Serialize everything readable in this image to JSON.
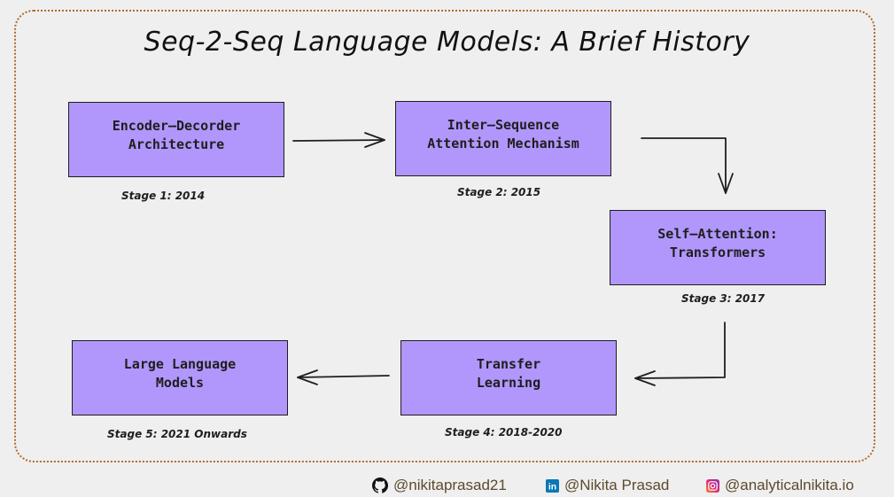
{
  "title": "Seq-2-Seq Language Models: A Brief History",
  "stages": [
    {
      "label": "Encoder—Decorder\nArchitecture",
      "caption": "Stage 1: 2014"
    },
    {
      "label": "Inter—Sequence\nAttention Mechanism",
      "caption": "Stage 2: 2015"
    },
    {
      "label": "Self—Attention:\nTransformers",
      "caption": "Stage 3: 2017"
    },
    {
      "label": "Transfer\nLearning",
      "caption": "Stage 4: 2018-2020"
    },
    {
      "label": "Large Language\nModels",
      "caption": "Stage 5: 2021 Onwards"
    }
  ],
  "colors": {
    "box_fill": "#b197fc",
    "frame_border": "#b06a2a",
    "footer_text": "#5c4a2e"
  },
  "footer": {
    "github": {
      "icon": "github-icon",
      "handle": "@nikitaprasad21"
    },
    "linkedin": {
      "icon": "linkedin-icon",
      "handle": "@Nikita Prasad"
    },
    "instagram": {
      "icon": "instagram-icon",
      "handle": "@analyticalnikita.io"
    }
  }
}
